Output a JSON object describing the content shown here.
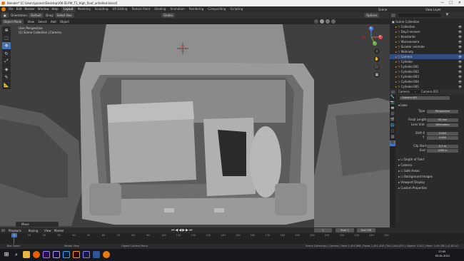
{
  "window": {
    "title": "Blender* [C:\\Users\\pooner\\Desktop\\VW-ID.PW_T1_High_Roof_unfolded.blend]"
  },
  "menus": [
    "File",
    "Edit",
    "Render",
    "Window",
    "Help"
  ],
  "workspaces": [
    "Layout",
    "Modeling",
    "Sculpting",
    "UV Editing",
    "Texture Paint",
    "Shading",
    "Animation",
    "Rendering",
    "Compositing",
    "Scripting"
  ],
  "active_workspace": "Layout",
  "scene": {
    "name": "Scene",
    "view_layer": "View Layer"
  },
  "header": {
    "orientation": "Orientation:",
    "orientation_value": "Default",
    "drag": "Drag:",
    "drag_value": "Select Box",
    "transform": "Global",
    "options": "Options"
  },
  "viewport_header": {
    "mode": "Object Mode",
    "menus": [
      "View",
      "Select",
      "Add",
      "Object"
    ]
  },
  "viewport_info": {
    "line1": "User Perspective",
    "line2": "(1) Scene Collection | Camera"
  },
  "tools": [
    "cursor-icon",
    "select-icon",
    "move-icon",
    "rotate-icon",
    "scale-icon",
    "transform-icon",
    "annotate-icon",
    "measure-icon"
  ],
  "gizmo": {
    "x": "X",
    "y": "Y",
    "z": "Z"
  },
  "outliner": {
    "title": "Scene Collection",
    "items": [
      {
        "name": "Collection"
      },
      {
        "name": "Day3 recover"
      },
      {
        "name": "Konstante"
      },
      {
        "name": "Wunsauswra"
      },
      {
        "name": "Scooter animate"
      },
      {
        "name": "Wohnaty"
      },
      {
        "name": "Camera"
      },
      {
        "name": "Cylinder"
      },
      {
        "name": "Cylinder.001"
      },
      {
        "name": "Cylinder.002"
      },
      {
        "name": "Cylinder.003"
      },
      {
        "name": "Cylinder.004"
      },
      {
        "name": "Cylinder.005"
      }
    ],
    "selected_index": 6
  },
  "properties": {
    "object": "Camera",
    "data": "Camera.001",
    "data_field": "Camera.001",
    "section_lens": "Lens",
    "type_label": "Type",
    "type_value": "Perspective",
    "focal_label": "Focal Length",
    "focal_value": "50 mm",
    "lens_unit_label": "Lens Unit",
    "lens_unit_value": "Millimeters",
    "shift_x_label": "Shift X",
    "shift_x_value": "0.000",
    "shift_y_label": "Y",
    "shift_y_value": "0.000",
    "clip_start_label": "Clip Start",
    "clip_start_value": "0.1 m",
    "clip_end_label": "End",
    "clip_end_value": "1000 m",
    "sections": [
      "Depth of Field",
      "Camera",
      "Safe Areas",
      "Background Images",
      "Viewport Display",
      "Custom Properties"
    ]
  },
  "timeline": {
    "menus": [
      "Playback",
      "Keying",
      "View",
      "Marker"
    ],
    "current_frame": "1",
    "start_label": "Start",
    "start": "1",
    "end_label": "End",
    "end": "250",
    "ticks": [
      "0",
      "10",
      "20",
      "30",
      "40",
      "50",
      "60",
      "70",
      "80",
      "90",
      "100",
      "110",
      "120",
      "130",
      "140",
      "150",
      "160",
      "170",
      "180",
      "190",
      "200",
      "210",
      "220",
      "230",
      "240",
      "250"
    ]
  },
  "operator_panel": {
    "label": "Move"
  },
  "status": {
    "select": "Box Select",
    "rotate": "Rotate View",
    "context": "Object Context Menu",
    "stats": "Scene Collection | Camera | Verts 1,491,698 | Faces 1,491,426 | Tris 2,944,415 | Objects 1/102 | Mem: 1.49 GiB | v2.83.10"
  },
  "taskbar": {
    "time": "17:05",
    "date": "05.01.2021",
    "apps": [
      "windows-icon",
      "search-icon",
      "explorer-icon",
      "firefox-icon",
      "premiere-icon",
      "after-effects-icon",
      "photoshop-icon",
      "illustrator-icon",
      "media-encoder-icon",
      "word-icon",
      "blender-icon"
    ]
  }
}
